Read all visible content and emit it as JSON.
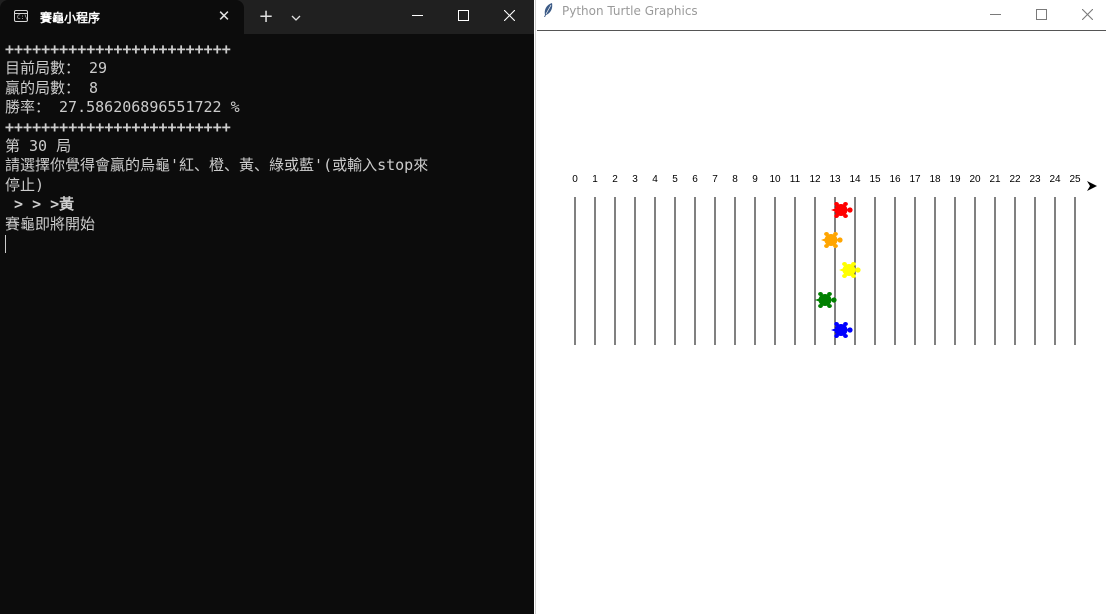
{
  "terminal": {
    "tab_title": "賽龜小程序",
    "new_tab_symbol": "+",
    "close_symbol": "✕",
    "lines": [
      "+++++++++++++++++++++++++",
      "目前局數： 29",
      "贏的局數： 8",
      "勝率： 27.586206896551722 %",
      "+++++++++++++++++++++++++",
      "第 30 局",
      "請選擇你覺得會贏的烏龜'紅、橙、黃、綠或藍'(或輸入stop來",
      "停止)",
      " > > >黃",
      "賽龜即將開始"
    ]
  },
  "turtle_window": {
    "title": "Python Turtle Graphics",
    "race": {
      "tick_labels": [
        "0",
        "1",
        "2",
        "3",
        "4",
        "5",
        "6",
        "7",
        "8",
        "9",
        "10",
        "11",
        "12",
        "13",
        "14",
        "15",
        "16",
        "17",
        "18",
        "19",
        "20",
        "21",
        "22",
        "23",
        "24",
        "25"
      ],
      "turtles": [
        {
          "name": "red",
          "color": "#ff0000",
          "position": 13.3
        },
        {
          "name": "orange",
          "color": "#ffa500",
          "position": 12.8
        },
        {
          "name": "yellow",
          "color": "#ffff00",
          "position": 13.7
        },
        {
          "name": "green",
          "color": "#008000",
          "position": 12.5
        },
        {
          "name": "blue",
          "color": "#0000ff",
          "position": 13.3
        }
      ]
    }
  }
}
